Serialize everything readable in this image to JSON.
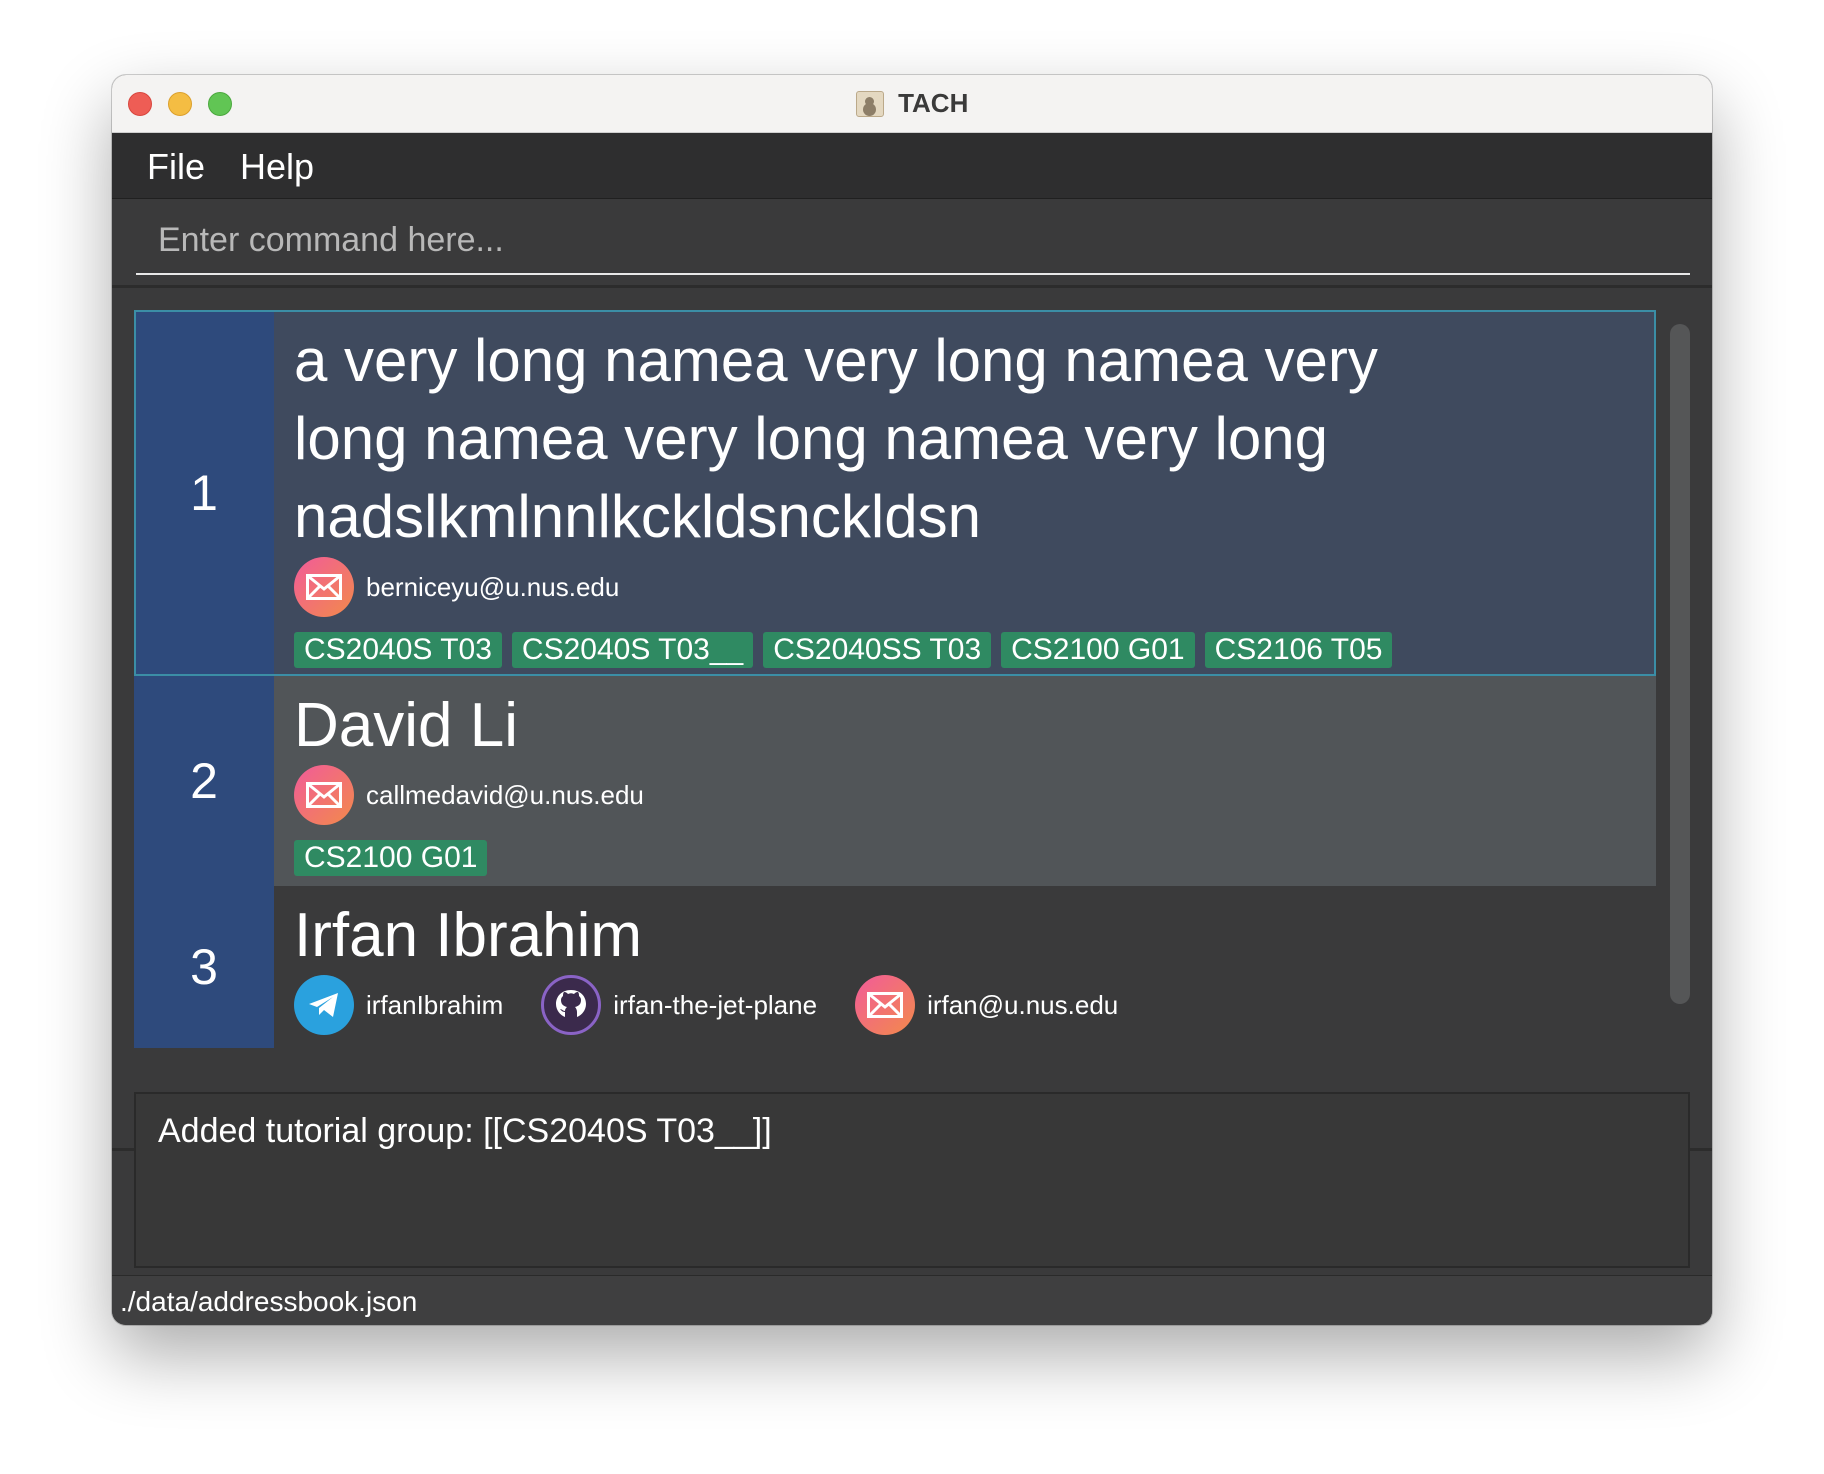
{
  "window": {
    "title": "TACH"
  },
  "menu": {
    "items": [
      "File",
      "Help"
    ]
  },
  "command": {
    "placeholder": "Enter command here...",
    "value": ""
  },
  "persons": [
    {
      "index": "1",
      "name": "a very long namea very long namea very long namea very long namea very long nadslkmlnnlkckldsnckldsn",
      "selected": true,
      "contacts": [
        {
          "type": "email",
          "icon": "email-icon",
          "value": "berniceyu@u.nus.edu"
        }
      ],
      "tags": [
        "CS2040S T03",
        "CS2040S T03__",
        "CS2040SS T03",
        "CS2100 G01",
        "CS2106 T05"
      ]
    },
    {
      "index": "2",
      "name": "David Li",
      "selected": false,
      "contacts": [
        {
          "type": "email",
          "icon": "email-icon",
          "value": "callmedavid@u.nus.edu"
        }
      ],
      "tags": [
        "CS2100 G01"
      ]
    },
    {
      "index": "3",
      "name": "Irfan Ibrahim",
      "selected": false,
      "contacts": [
        {
          "type": "telegram",
          "icon": "telegram-icon",
          "value": "irfanIbrahim"
        },
        {
          "type": "github",
          "icon": "github-icon",
          "value": "irfan-the-jet-plane"
        },
        {
          "type": "email",
          "icon": "email-icon",
          "value": "irfan@u.nus.edu"
        }
      ],
      "tags": []
    }
  ],
  "result": {
    "message": "Added tutorial group: [[CS2040S T03__]]"
  },
  "status": {
    "file_path": "./data/addressbook.json"
  },
  "colors": {
    "index_bg": "#2e4a7c",
    "selected_card_bg": "#3f4a5e",
    "tag_bg": "#2f8a62",
    "telegram": "#2aa1de"
  }
}
